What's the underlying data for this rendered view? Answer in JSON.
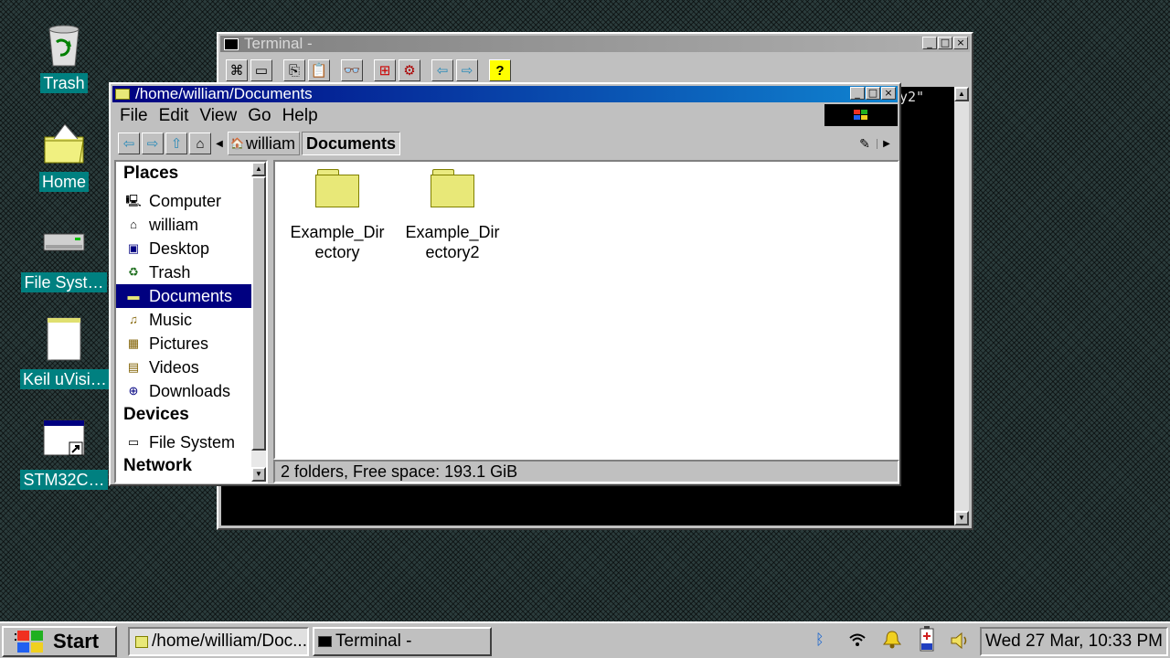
{
  "desktop_icons": [
    {
      "label": "Trash",
      "icon": "trash-icon"
    },
    {
      "label": "Home",
      "icon": "home-folder-icon"
    },
    {
      "label": "File Syst…",
      "icon": "drive-icon"
    },
    {
      "label": "Keil uVisi…",
      "icon": "document-icon"
    },
    {
      "label": "STM32C…",
      "icon": "shortcut-icon"
    }
  ],
  "terminal": {
    "title": "Terminal -",
    "visible_text": "y2\""
  },
  "file_manager": {
    "title": "/home/william/Documents",
    "menu": [
      "File",
      "Edit",
      "View",
      "Go",
      "Help"
    ],
    "path": [
      "william",
      "Documents"
    ],
    "places_heading": "Places",
    "places": [
      {
        "label": "Computer",
        "icon": "computer-icon"
      },
      {
        "label": "william",
        "icon": "home-icon"
      },
      {
        "label": "Desktop",
        "icon": "desktop-icon"
      },
      {
        "label": "Trash",
        "icon": "trash-icon"
      },
      {
        "label": "Documents",
        "icon": "documents-icon"
      },
      {
        "label": "Music",
        "icon": "music-icon"
      },
      {
        "label": "Pictures",
        "icon": "pictures-icon"
      },
      {
        "label": "Videos",
        "icon": "videos-icon"
      },
      {
        "label": "Downloads",
        "icon": "downloads-icon"
      }
    ],
    "selected_place": "Documents",
    "devices_heading": "Devices",
    "devices": [
      {
        "label": "File System",
        "icon": "drive-icon"
      }
    ],
    "network_heading": "Network",
    "items": [
      {
        "name_line1": "Example_Dir",
        "name_line2": "ectory"
      },
      {
        "name_line1": "Example_Dir",
        "name_line2": "ectory2"
      }
    ],
    "status": "2 folders, Free space: 193.1 GiB"
  },
  "taskbar": {
    "start_label": "Start",
    "tasks": [
      {
        "label": "/home/william/Doc...",
        "icon": "folder-icon",
        "active": true
      },
      {
        "label": "Terminal -",
        "icon": "terminal-icon",
        "active": false
      }
    ],
    "clock": "Wed 27 Mar, 10:33 PM"
  },
  "colors": {
    "active_title": "#000080",
    "inactive_title": "#808080",
    "desktop_label_bg": "#008080",
    "selection": "#000080"
  }
}
